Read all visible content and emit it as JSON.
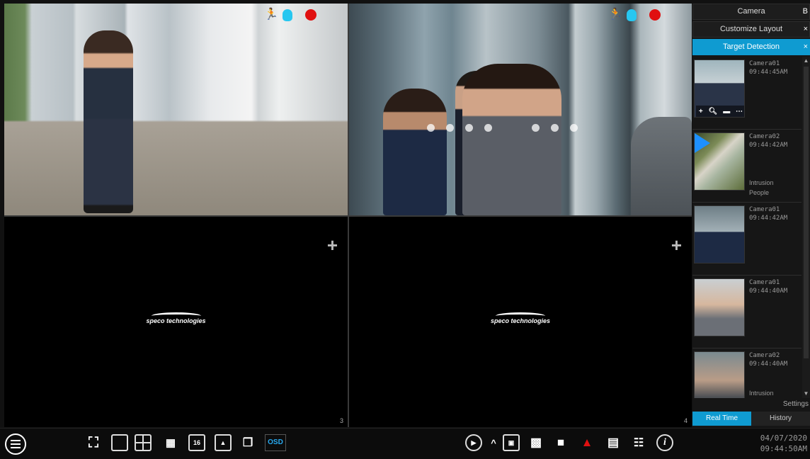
{
  "channels": [
    {
      "id": 1,
      "number": "",
      "add_icon": "",
      "logo_text": ""
    },
    {
      "id": 2,
      "number": "",
      "add_icon": "",
      "logo_text": ""
    },
    {
      "id": 3,
      "number": "3",
      "add_icon": "+",
      "logo_text": "speco technologies"
    },
    {
      "id": 4,
      "number": "4",
      "add_icon": "+",
      "logo_text": "speco technologies"
    }
  ],
  "panel": {
    "headers": {
      "camera": "Camera",
      "customize_layout": "Customize Layout",
      "target_detection": "Target Detection"
    },
    "close_glyph": "×",
    "camera_trailing": "B",
    "items": [
      {
        "camera": "Camera01",
        "time": "09:44:45AM",
        "event": "",
        "subtype": ""
      },
      {
        "camera": "Camera02",
        "time": "09:44:42AM",
        "event": "Intrusion",
        "subtype": "People"
      },
      {
        "camera": "Camera01",
        "time": "09:44:42AM",
        "event": "",
        "subtype": ""
      },
      {
        "camera": "Camera01",
        "time": "09:44:40AM",
        "event": "",
        "subtype": ""
      },
      {
        "camera": "Camera02",
        "time": "09:44:40AM",
        "event": "Intrusion",
        "subtype": ""
      }
    ],
    "settings_label": "Settings",
    "tabs": {
      "realtime": "Real Time",
      "history": "History"
    }
  },
  "toolbar": {
    "split_16_label": "16",
    "osd_label": "OSD",
    "chevron": "^"
  },
  "clock": {
    "date": "04/07/2020",
    "time": "09:44:50AM"
  },
  "colors": {
    "accent": "#0f9bd1",
    "record": "#e01010",
    "motion": "#f3c400",
    "face": "#27c7f0"
  },
  "icons": [
    "menu-icon",
    "fullscreen-icon",
    "single-view-icon",
    "quad-view-icon",
    "nine-view-icon",
    "sixteen-view-icon",
    "custom-layout-icon",
    "sequence-icon",
    "play-icon",
    "snapshot-icon",
    "manual-record-icon",
    "audio-icon",
    "alarm-icon",
    "disk-icon",
    "network-icon",
    "info-icon"
  ]
}
